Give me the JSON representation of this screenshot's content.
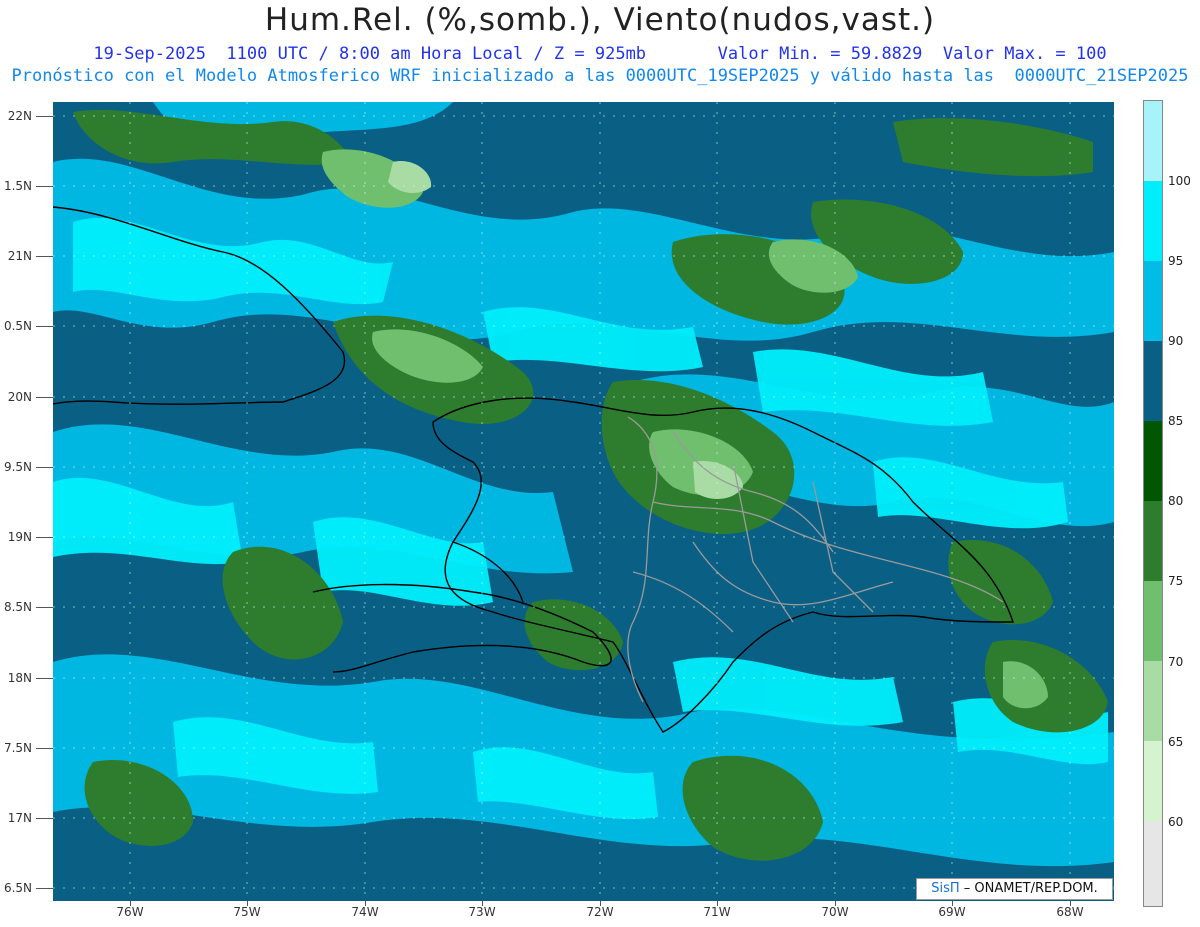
{
  "header": {
    "title": "Hum.Rel. (%,somb.), Viento(nudos,vast.)",
    "line1": "19-Sep-2025  1100 UTC / 8:00 am Hora Local / Z = 925mb       Valor Min. = 59.8829  Valor Max. = 100",
    "line2": "Pronóstico con el Modelo Atmosferico WRF inicializado a las 0000UTC_19SEP2025 y válido hasta las  0000UTC_21SEP2025"
  },
  "axes": {
    "lat_labels": [
      "22N",
      "1.5N",
      "21N",
      "0.5N",
      "20N",
      "9.5N",
      "19N",
      "8.5N",
      "18N",
      "7.5N",
      "17N",
      "6.5N"
    ],
    "lon_labels": [
      "76W",
      "75W",
      "74W",
      "73W",
      "72W",
      "71W",
      "70W",
      "69W",
      "68W"
    ]
  },
  "colorbar": {
    "labels": [
      "100",
      "95",
      "90",
      "85",
      "80",
      "75",
      "70",
      "65",
      "60"
    ],
    "colors": [
      "#a8f3f9",
      "#00eefc",
      "#00bce6",
      "#0a5f85",
      "#005700",
      "#2e7d2e",
      "#6fbf6f",
      "#a9dca5",
      "#d6f3d0",
      "#e6e6e6"
    ]
  },
  "credit": {
    "brand": "SisΠ",
    "text": "– ONAMET/REP.DOM."
  }
}
